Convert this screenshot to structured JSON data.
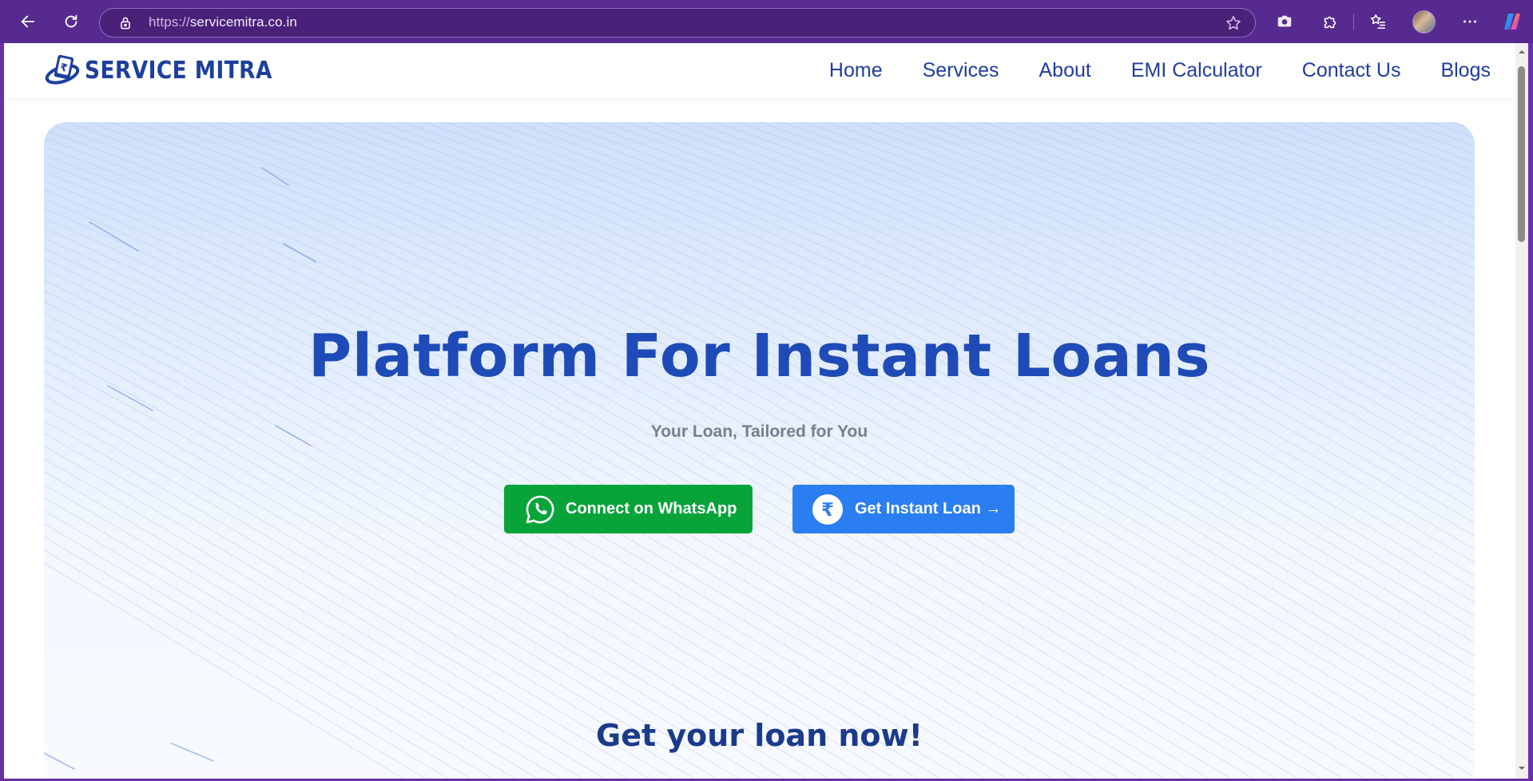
{
  "browser": {
    "url_protocol": "https://",
    "url_host": "servicemitra.co.in",
    "chrome_color": "#572a8f"
  },
  "site": {
    "logo_text": "SERVICE MITRA",
    "nav_items": [
      "Home",
      "Services",
      "About",
      "EMI Calculator",
      "Contact Us",
      "Blogs"
    ]
  },
  "hero": {
    "title": "Platform For Instant Loans",
    "subtitle": "Your Loan, Tailored for You",
    "whatsapp_button": "Connect on WhatsApp",
    "loan_button": "Get Instant Loan →",
    "loan_icon_symbol": "₹"
  },
  "section": {
    "heading": "Get your loan now!"
  },
  "colors": {
    "brand_blue": "#1e4bb7",
    "whatsapp_green": "#08a43a",
    "loan_blue": "#2b7df2"
  },
  "icons": {
    "back": "back-arrow-icon",
    "refresh": "refresh-icon",
    "lock": "lock-icon",
    "favorite": "star-icon",
    "screenshot": "camera-icon",
    "extensions": "puzzle-icon",
    "favorites": "favorites-list-icon",
    "menu": "more-icon",
    "copilot": "copilot-icon",
    "whatsapp": "whatsapp-icon",
    "rupee": "rupee-icon"
  }
}
